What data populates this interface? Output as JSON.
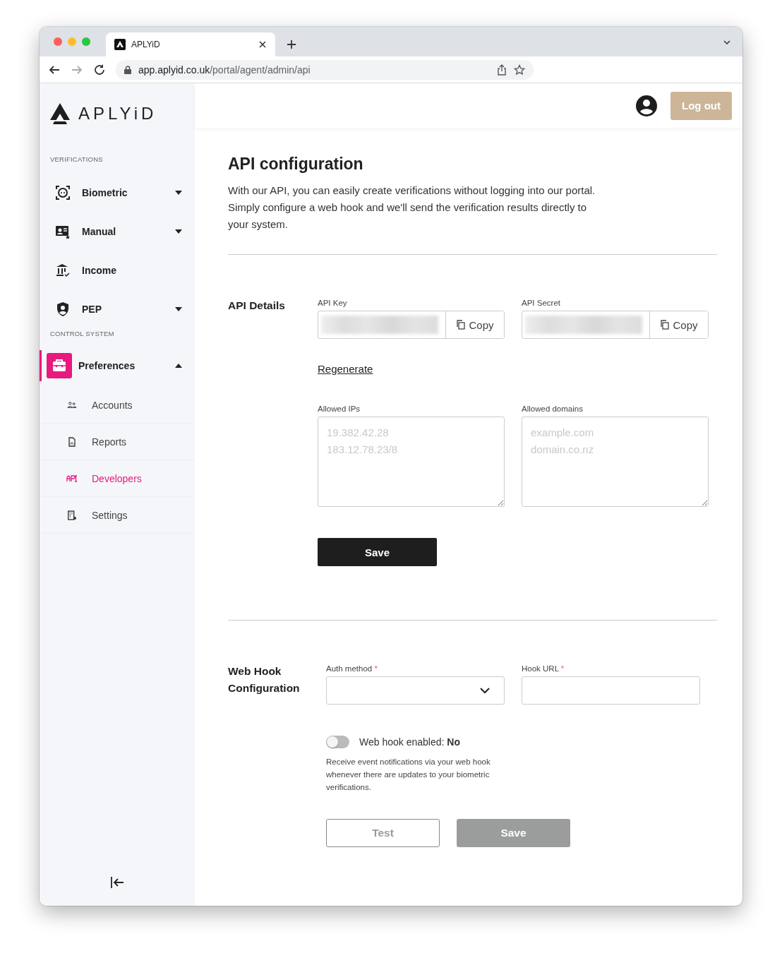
{
  "browser": {
    "tab_title": "APLYiD",
    "url_host": "app.aplyid.co.uk",
    "url_path": "/portal/agent/admin/api"
  },
  "sidebar": {
    "logo": "APLYiD",
    "sections": [
      {
        "title": "VERIFICATIONS",
        "items": [
          {
            "label": "Biometric",
            "expanded": false,
            "selected": false
          },
          {
            "label": "Manual",
            "expanded": false,
            "selected": false
          },
          {
            "label": "Income",
            "selected": false
          },
          {
            "label": "PEP",
            "expanded": false,
            "selected": false
          }
        ]
      },
      {
        "title": "CONTROL SYSTEM",
        "items": [
          {
            "label": "Preferences",
            "expanded": true,
            "selected": true,
            "children": [
              {
                "label": "Accounts",
                "selected": false
              },
              {
                "label": "Reports",
                "selected": false
              },
              {
                "label": "Developers",
                "selected": true
              },
              {
                "label": "Settings",
                "selected": false
              }
            ]
          }
        ]
      }
    ]
  },
  "header": {
    "logout": "Log out"
  },
  "page": {
    "title": "API configuration",
    "description": "With our API, you can easily create verifications without logging into our portal. Simply configure a web hook and we'll send the verification results directly to your system."
  },
  "api_details": {
    "title": "API Details",
    "credentials": [
      {
        "label": "API Key",
        "copy": "Copy"
      },
      {
        "label": "API Secret",
        "copy": "Copy"
      }
    ],
    "regenerate": "Regenerate",
    "allowed": [
      {
        "label": "Allowed IPs",
        "placeholder": "19.382.42.28\n183.12.78.23/8"
      },
      {
        "label": "Allowed domains",
        "placeholder": "example.com\ndomain.co.nz"
      }
    ],
    "save": "Save"
  },
  "web_hook": {
    "title": "Web Hook Configuration",
    "auth_method": {
      "label": "Auth method",
      "required_mark": "*"
    },
    "hook_url": {
      "label": "Hook URL",
      "required_mark": "*"
    },
    "toggle": {
      "on": false,
      "label": "Web hook enabled: **No**"
    },
    "help": "Receive event notifications via your web hook whenever there are updates to your biometric verifications.",
    "buttons": [
      {
        "label": "Test",
        "kind": "outline",
        "disabled": true
      },
      {
        "label": "Save",
        "kind": "filled",
        "disabled": true
      }
    ]
  }
}
